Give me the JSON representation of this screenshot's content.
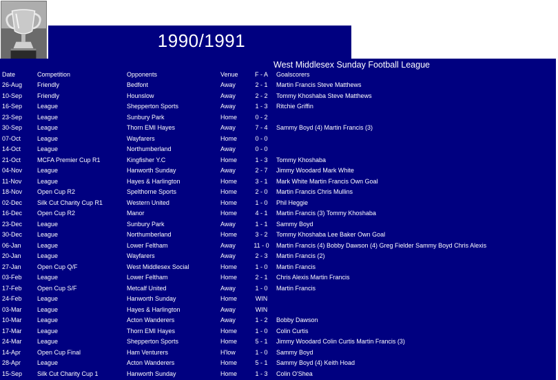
{
  "season": "1990/1991",
  "league_name": "West Middlesex Sunday Football League",
  "headers": {
    "date": "Date",
    "competition": "Competition",
    "opponents": "Opponents",
    "venue": "Venue",
    "score": "F  -  A",
    "scorers": "Goalscorers"
  },
  "matches": [
    {
      "date": "26-Aug",
      "competition": "Friendly",
      "opponents": "Bedfont",
      "venue": "Away",
      "score": "2  -  1",
      "scorers": "Martin Francis  Steve Matthews"
    },
    {
      "date": "10-Sep",
      "competition": "Friendly",
      "opponents": "Hounslow",
      "venue": "Away",
      "score": "2  -  2",
      "scorers": "Tommy Khoshaba  Steve Matthews"
    },
    {
      "date": "16-Sep",
      "competition": "League",
      "opponents": "Shepperton Sports",
      "venue": "Away",
      "score": "1  -  3",
      "scorers": "Ritchie Griffin"
    },
    {
      "date": "23-Sep",
      "competition": "League",
      "opponents": "Sunbury Park",
      "venue": "Home",
      "score": "0  -  2",
      "scorers": ""
    },
    {
      "date": "30-Sep",
      "competition": "League",
      "opponents": "Thorn EMI Hayes",
      "venue": "Away",
      "score": "7  -  4",
      "scorers": "Sammy Boyd (4)  Martin Francis (3)"
    },
    {
      "date": "07-Oct",
      "competition": "League",
      "opponents": "Wayfarers",
      "venue": "Home",
      "score": "0  -  0",
      "scorers": ""
    },
    {
      "date": "14-Oct",
      "competition": "League",
      "opponents": "Northumberland",
      "venue": "Away",
      "score": "0  -  0",
      "scorers": ""
    },
    {
      "date": "21-Oct",
      "competition": "MCFA Premier Cup R1",
      "opponents": "Kingfisher Y.C",
      "venue": "Home",
      "score": "1  -  3",
      "scorers": "Tommy Khoshaba"
    },
    {
      "date": "04-Nov",
      "competition": "League",
      "opponents": "Hanworth Sunday",
      "venue": "Away",
      "score": "2  -  7",
      "scorers": "Jimmy Woodard  Mark White"
    },
    {
      "date": "11-Nov",
      "competition": "League",
      "opponents": "Hayes & Harlington",
      "venue": "Home",
      "score": "3  -  1",
      "scorers": "Mark White  Martin Francis  Own Goal"
    },
    {
      "date": "18-Nov",
      "competition": "Open Cup R2",
      "opponents": "Spelthorne Sports",
      "venue": "Home",
      "score": "2  -  0",
      "scorers": "Martin Francis  Chris Mullins"
    },
    {
      "date": "02-Dec",
      "competition": "Silk Cut Charity Cup R1",
      "opponents": "Western United",
      "venue": "Home",
      "score": "1  -  0",
      "scorers": "Phil Heggie"
    },
    {
      "date": "16-Dec",
      "competition": "Open Cup R2",
      "opponents": "Manor",
      "venue": "Home",
      "score": "4  -  1",
      "scorers": "Martin Francis (3)  Tommy Khoshaba"
    },
    {
      "date": "23-Dec",
      "competition": "League",
      "opponents": "Sunbury Park",
      "venue": "Away",
      "score": "1  -  1",
      "scorers": "Sammy Boyd"
    },
    {
      "date": "30-Dec",
      "competition": "League",
      "opponents": "Northumberland",
      "venue": "Home",
      "score": "3  -  2",
      "scorers": "Tommy Khoshaba  Lee Baker  Own Goal"
    },
    {
      "date": "06-Jan",
      "competition": "League",
      "opponents": "Lower Feltham",
      "venue": "Away",
      "score": "11 -  0",
      "scorers": "Martin Francis (4)  Bobby Dawson (4) Greg Fielder Sammy Boyd Chris Alexis"
    },
    {
      "date": "20-Jan",
      "competition": "League",
      "opponents": "Wayfarers",
      "venue": "Away",
      "score": "2  -  3",
      "scorers": "Martin Francis (2)"
    },
    {
      "date": "27-Jan",
      "competition": "Open Cup Q/F",
      "opponents": "West Middlesex Social",
      "venue": "Home",
      "score": "1  -  0",
      "scorers": "Martin Francis"
    },
    {
      "date": "03-Feb",
      "competition": "League",
      "opponents": "Lower Feltham",
      "venue": "Home",
      "score": "2  -  1",
      "scorers": "Chris Alexis  Martin Francis"
    },
    {
      "date": "17-Feb",
      "competition": "Open Cup S/F",
      "opponents": "Metcalf United",
      "venue": "Away",
      "score": "1  -  0",
      "scorers": "Martin Francis"
    },
    {
      "date": "24-Feb",
      "competition": "League",
      "opponents": "Hanworth Sunday",
      "venue": "Home",
      "score": "WIN",
      "scorers": ""
    },
    {
      "date": "03-Mar",
      "competition": "League",
      "opponents": "Hayes & Harlington",
      "venue": "Away",
      "score": "WIN",
      "scorers": ""
    },
    {
      "date": "10-Mar",
      "competition": "League",
      "opponents": "Acton Wanderers",
      "venue": "Away",
      "score": "1  -  2",
      "scorers": "Bobby Dawson"
    },
    {
      "date": "17-Mar",
      "competition": "League",
      "opponents": "Thorn EMI Hayes",
      "venue": "Home",
      "score": "1  -  0",
      "scorers": "Colin Curtis"
    },
    {
      "date": "24-Mar",
      "competition": "League",
      "opponents": "Shepperton Sports",
      "venue": "Home",
      "score": "5  -  1",
      "scorers": "Jimmy Woodard  Colin Curtis  Martin Francis (3)"
    },
    {
      "date": "14-Apr",
      "competition": "Open Cup Final",
      "opponents": "Ham Venturers",
      "venue": "H'low",
      "score": "1  -  0",
      "scorers": "Sammy Boyd"
    },
    {
      "date": "28-Apr",
      "competition": "League",
      "opponents": "Acton Wanderers",
      "venue": "Home",
      "score": "5  -  1",
      "scorers": "Sammy Boyd (4) Keith Hoad"
    },
    {
      "date": "15-Sep",
      "competition": "Silk Cut Charity Cup 1",
      "opponents": "Hanworth Sunday",
      "venue": "Home",
      "score": "1  -  3",
      "scorers": "Colin O'Shea"
    }
  ]
}
